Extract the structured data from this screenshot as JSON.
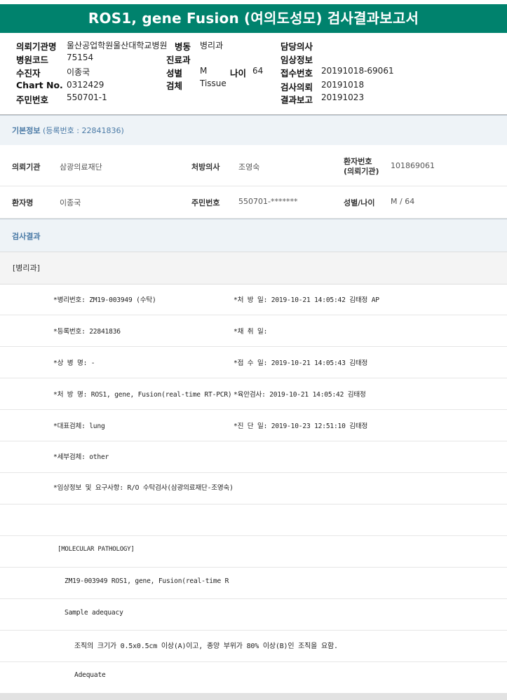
{
  "title": "ROS1, gene Fusion (여의도성모) 검사결과보고서",
  "header": {
    "requesting_org_label": "의뢰기관명",
    "requesting_org_value": "울산공업학원울산대학교병원",
    "ward_label": "병동",
    "ward_value": "병리과",
    "attending_label": "담당의사",
    "hospital_code_label": "병원코드",
    "hospital_code_value": "75154",
    "department_label": "진료과",
    "clinical_info_label": "임상정보",
    "patient_label": "수진자",
    "patient_value": "이종국",
    "sex_label": "성별",
    "sex_value": "M",
    "age_label": "나이",
    "age_value": "64",
    "receipt_label": "접수번호",
    "receipt_value": "20191018-69061",
    "chart_label": "Chart No.",
    "chart_value": "0312429",
    "specimen_label": "검체",
    "specimen_value": "Tissue",
    "request_label": "검사의뢰",
    "request_value": "20191018",
    "id_label": "주민번호",
    "id_value": "550701-1",
    "report_label": "결과보고",
    "report_value": "20191023"
  },
  "basic_info": {
    "section_title": "기본정보",
    "reg_text": "(등록번호 : 22841836)",
    "org_label": "의뢰기관",
    "org_value": "삼광의료재단",
    "doctor_label": "처방의사",
    "doctor_value": "조영숙",
    "patient_no_label_1": "환자번호",
    "patient_no_label_2": "(의뢰기관)",
    "patient_no_value": "101869061",
    "name_label": "환자명",
    "name_value": "이종국",
    "id_label": "주민번호",
    "id_value": "550701-*******",
    "sexage_label": "성별/나이",
    "sexage_value": "M / 64"
  },
  "results": {
    "section_title": "검사결과",
    "dept_tag": "[병리과]",
    "rows": [
      {
        "left": "*병리번호: ZM19-003949 (수탁)",
        "right": "*처 방 일: 2019-10-21 14:05:42  김태정 AP"
      },
      {
        "left": "*등록번호: 22841836",
        "right": "*채 취 일:"
      },
      {
        "left": "*상 병 명: -",
        "right": "*접 수 일: 2019-10-21 14:05:43  김태정"
      },
      {
        "left": "*처 방 명: ROS1, gene, Fusion(real-time RT-PCR)",
        "right": "*육안검사: 2019-10-21 14:05:42  김태정"
      },
      {
        "left": "*대표검체: lung",
        "right": "*진 단 일: 2019-10-23 12:51:10  김태정"
      },
      {
        "left": "*세부검체: other",
        "right": ""
      },
      {
        "left": "*임상정보 및 요구사항: R/O 수탁검사(삼광의료재단-조영숙)",
        "right": ""
      }
    ],
    "molecular_header": "[MOLECULAR PATHOLOGY]",
    "molecular_line": "ZM19-003949     ROS1, gene, Fusion(real-time R",
    "sample_adequacy": "Sample adequacy",
    "tissue_note": "조직의 크기가 0.5x0.5cm 이상(A)이고, 종양 부위가 80% 이상(B)인 조직을 요함.",
    "adequate": "Adequate"
  }
}
